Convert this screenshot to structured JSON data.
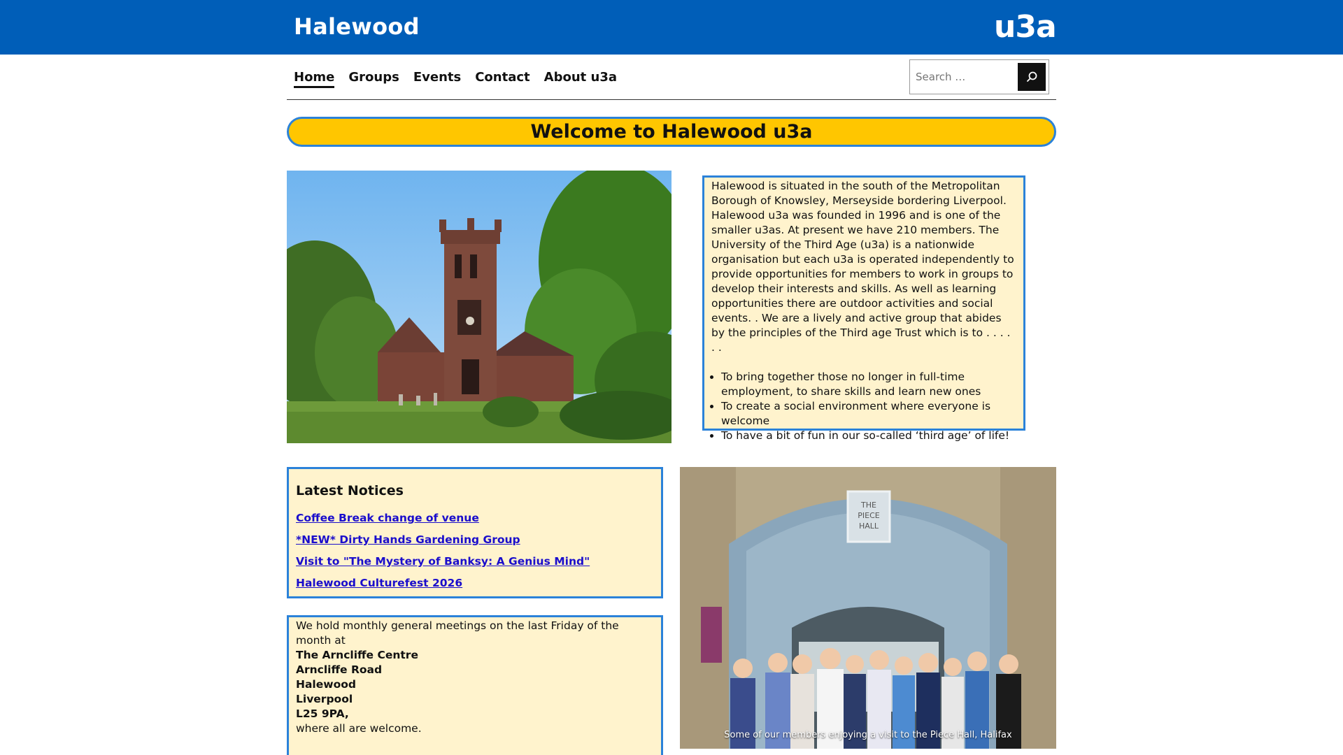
{
  "header": {
    "site_title": "Halewood",
    "logo_text": "u3a",
    "bg_color": "#005eb8"
  },
  "nav": {
    "items": [
      {
        "label": "Home",
        "active": true
      },
      {
        "label": "Groups"
      },
      {
        "label": "Events"
      },
      {
        "label": "Contact"
      },
      {
        "label": "About u3a"
      }
    ],
    "search_placeholder": "Search …"
  },
  "welcome": {
    "title": "Welcome to Halewood u3a",
    "bg_color": "#ffc600",
    "border_color": "#2b82d9"
  },
  "intro": {
    "paragraph": "Halewood is situated in the south of the Metropolitan Borough of Knowsley, Merseyside bordering Liverpool. Halewood u3a was founded in 1996 and is one of the smaller u3as. At present we have 210 members. The University of the Third Age (u3a) is a nationwide organisation but each u3a is operated independently to provide opportunities for members to work in groups to develop their interests and skills. As well as learning opportunities there are outdoor activities and social events. . We are a lively and active group that abides by the principles of the Third age Trust which is to . . . . . .",
    "bullets": [
      "To bring together those no longer in full-time employment, to share skills and learn new ones",
      "To create a social environment where everyone is welcome",
      "To have a bit of fun in our so-called ‘third age’ of life!"
    ],
    "bg_color": "#fff3cd"
  },
  "notices": {
    "title": "Latest Notices",
    "links": [
      "Coffee Break change of venue",
      "*NEW* Dirty Hands Gardening Group",
      "Visit to \"The Mystery of Banksy: A Genius Mind\"",
      "Halewood Culturefest 2026"
    ],
    "link_color": "#1a0dcc"
  },
  "meetings": {
    "intro": "We hold monthly general meetings on the last Friday of the month at",
    "address": [
      "The Arncliffe Centre",
      "Arncliffe Road",
      "Halewood",
      "Liverpool",
      "L25 9PA,"
    ],
    "outro": "where all are welcome."
  },
  "photo": {
    "caption": "Some of our members enjoying a visit to the Piece Hall, Halifax",
    "sign_lines": [
      "THE",
      "PIECE",
      "HALL"
    ]
  }
}
